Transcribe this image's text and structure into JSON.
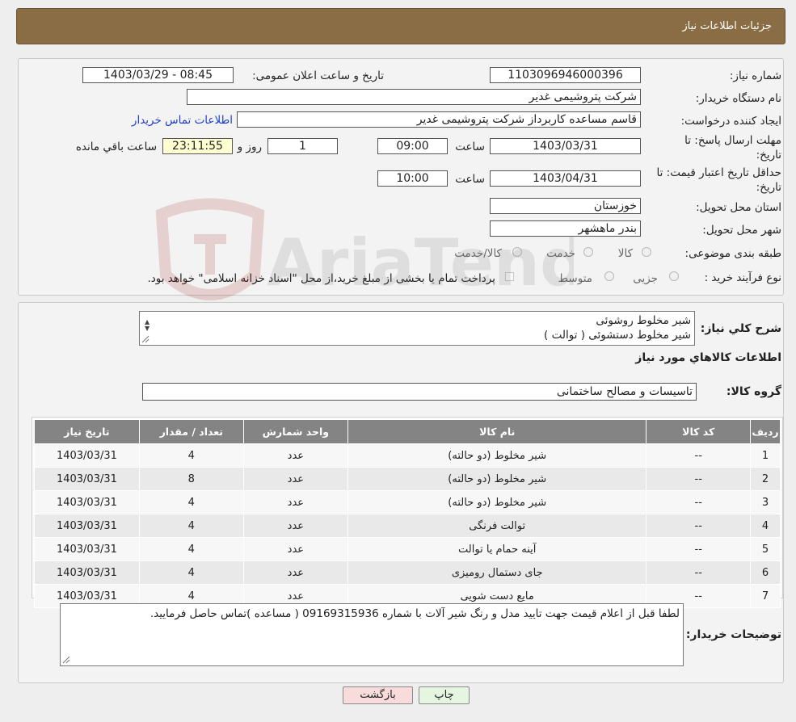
{
  "header": {
    "title": "جزئیات اطلاعات نیاز"
  },
  "form": {
    "need_number_label": "شماره نیاز:",
    "need_number": "1103096946000396",
    "announce_label": "تاریخ و ساعت اعلان عمومی:",
    "announce_value": "1403/03/29 - 08:45",
    "buyer_org_label": "نام دستگاه خریدار:",
    "buyer_org": "شرکت پتروشیمی غدیر",
    "creator_label": "ایجاد کننده درخواست:",
    "creator": "قاسم مساعده کاربرداز شرکت پتروشیمی غدیر",
    "contact_link": "اطلاعات تماس خریدار",
    "deadline_label_1": "مهلت ارسال پاسخ: تا",
    "deadline_label_2": "تاریخ:",
    "deadline_date": "1403/03/31",
    "time_label": "ساعت",
    "deadline_time": "09:00",
    "days_value": "1",
    "days_label": "روز و",
    "remaining_time": "23:11:55",
    "remaining_label": "ساعت باقي مانده",
    "validity_label_1": "حداقل تاریخ اعتبار قیمت: تا",
    "validity_label_2": "تاریخ:",
    "validity_date": "1403/04/31",
    "validity_time": "10:00",
    "province_label": "استان محل تحویل:",
    "province": "خوزستان",
    "city_label": "شهر محل تحویل:",
    "city": "بندر ماهشهر",
    "category_label": "طبقه بندی موضوعی:",
    "category_options": [
      "کالا",
      "خدمت",
      "کالا/خدمت"
    ],
    "process_label": "نوع فرآیند خرید :",
    "process_options": [
      "جزیی",
      "متوسط"
    ],
    "process_note": "پرداخت تمام یا بخشی از مبلغ خرید،از محل \"اسناد خزانه اسلامی\" خواهد بود."
  },
  "details": {
    "summary_label": "شرح کلي نياز:",
    "summary_lines": [
      "شیر مخلوط روشوئی",
      "شیر مخلوط دستشوئی ( توالت )"
    ],
    "goods_info_title": "اطلاعات کالاهاي مورد نياز",
    "goods_group_label": "گروه کالا:",
    "goods_group": "تاسیسات و مصالح ساختمانی"
  },
  "table": {
    "headers": [
      "ردیف",
      "کد کالا",
      "نام کالا",
      "واحد شمارش",
      "تعداد / مقدار",
      "تاریخ نیاز"
    ],
    "rows": [
      [
        "1",
        "--",
        "شیر مخلوط (دو حالته)",
        "عدد",
        "4",
        "1403/03/31"
      ],
      [
        "2",
        "--",
        "شیر مخلوط (دو حالته)",
        "عدد",
        "8",
        "1403/03/31"
      ],
      [
        "3",
        "--",
        "شیر مخلوط (دو حالته)",
        "عدد",
        "4",
        "1403/03/31"
      ],
      [
        "4",
        "--",
        "توالت فرنگی",
        "عدد",
        "4",
        "1403/03/31"
      ],
      [
        "5",
        "--",
        "آینه حمام یا توالت",
        "عدد",
        "4",
        "1403/03/31"
      ],
      [
        "6",
        "--",
        "جای دستمال رومیزی",
        "عدد",
        "4",
        "1403/03/31"
      ],
      [
        "7",
        "--",
        "مایع دست شویی",
        "عدد",
        "4",
        "1403/03/31"
      ]
    ]
  },
  "buyer_notes": {
    "label": "توضیحات خریدار:",
    "text": "لطفا قبل از اعلام قیمت جهت تایید مدل و رنگ شیر آلات با شماره 09169315936 ( مساعده )تماس حاصل فرمایید."
  },
  "buttons": {
    "print": "چاپ",
    "back": "بازگشت"
  },
  "watermark": {
    "text": "AriaTender.neT"
  },
  "colors": {
    "header": "#8a6d45",
    "table_header": "#848484",
    "print_button": "#e4f6e0",
    "back_button": "#f8dcdc",
    "link": "#1f3fcf"
  }
}
